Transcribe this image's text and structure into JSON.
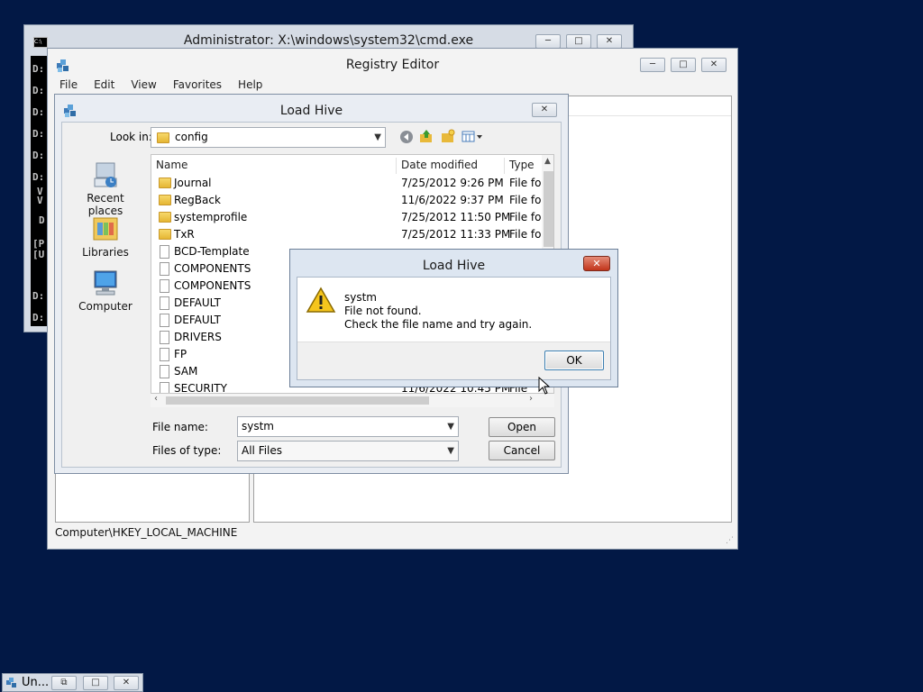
{
  "cmd_window": {
    "title": "Administrator: X:\\windows\\system32\\cmd.exe",
    "console_lines": [
      "D:",
      "D:",
      "D:",
      "D:",
      "D:",
      "D:",
      "V",
      "V",
      "D",
      "[P",
      "[U",
      "D:",
      "D:"
    ],
    "icon_text": "C:\\",
    "buttons": [
      "─",
      "□",
      "✕"
    ]
  },
  "registry_editor": {
    "title": "Registry Editor",
    "menu": [
      "File",
      "Edit",
      "View",
      "Favorites",
      "Help"
    ],
    "status_path": "Computer\\HKEY_LOCAL_MACHINE",
    "buttons": [
      "─",
      "□",
      "✕"
    ]
  },
  "load_hive_dialog": {
    "title": "Load Hive",
    "close": "✕",
    "look_in_label": "Look in:",
    "look_in_value": "config",
    "places": [
      "Recent places",
      "Libraries",
      "Computer"
    ],
    "columns": [
      "Name",
      "Date modified",
      "Type"
    ],
    "files": [
      {
        "name": "Journal",
        "date": "7/25/2012 9:26 PM",
        "type": "File fol",
        "kind": "folder"
      },
      {
        "name": "RegBack",
        "date": "11/6/2022 9:37 PM",
        "type": "File fol",
        "kind": "folder"
      },
      {
        "name": "systemprofile",
        "date": "7/25/2012 11:50 PM",
        "type": "File fol",
        "kind": "folder"
      },
      {
        "name": "TxR",
        "date": "7/25/2012 11:33 PM",
        "type": "File fol",
        "kind": "folder"
      },
      {
        "name": "BCD-Template",
        "date": "",
        "type": "",
        "kind": "file"
      },
      {
        "name": "COMPONENTS",
        "date": "",
        "type": "",
        "kind": "file"
      },
      {
        "name": "COMPONENTS",
        "date": "",
        "type": "",
        "kind": "file"
      },
      {
        "name": "DEFAULT",
        "date": "",
        "type": "",
        "kind": "file"
      },
      {
        "name": "DEFAULT",
        "date": "",
        "type": "",
        "kind": "file"
      },
      {
        "name": "DRIVERS",
        "date": "",
        "type": "",
        "kind": "file"
      },
      {
        "name": "FP",
        "date": "",
        "type": "",
        "kind": "file"
      },
      {
        "name": "SAM",
        "date": "",
        "type": "",
        "kind": "file"
      },
      {
        "name": "SECURITY",
        "date": "11/6/2022 10:45 PM",
        "type": "File",
        "kind": "file"
      }
    ],
    "filename_label": "File name:",
    "filename_value": "systm",
    "filetype_label": "Files of type:",
    "filetype_value": "All Files",
    "open_button": "Open",
    "cancel_button": "Cancel"
  },
  "error_box": {
    "title": "Load Hive",
    "close": "✕",
    "line1": "systm",
    "line2": "File not found.",
    "line3": "Check the file name and try again.",
    "ok_button": "OK"
  },
  "taskbar": {
    "label": "Un...",
    "buttons": [
      "⧉",
      "□",
      "✕"
    ]
  },
  "colors": {
    "desktop": "#021845",
    "warning": "#f5c51d",
    "close_red": "#c1341a"
  }
}
